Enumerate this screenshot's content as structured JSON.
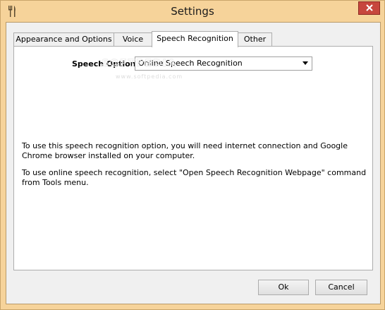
{
  "window": {
    "title": "Settings"
  },
  "tabs": [
    {
      "label": "Appearance and Options"
    },
    {
      "label": "Voice"
    },
    {
      "label": "Speech Recognition"
    },
    {
      "label": "Other"
    }
  ],
  "active_tab": "Speech Recognition",
  "speech_option": {
    "label": "Speech Option:",
    "value": "Online Speech Recognition"
  },
  "watermark": {
    "text": "SOFTPEDIA",
    "url": "www.softpedia.com"
  },
  "info": {
    "line1": "To use this speech recognition option, you will need internet connection and Google Chrome browser installed on your computer.",
    "line2": "To use online speech recognition, select \"Open Speech Recognition Webpage\" command from Tools menu."
  },
  "buttons": {
    "ok": "Ok",
    "cancel": "Cancel"
  },
  "colors": {
    "frame": "#f6d39a",
    "close": "#c7463d",
    "client": "#f0f0f0"
  }
}
